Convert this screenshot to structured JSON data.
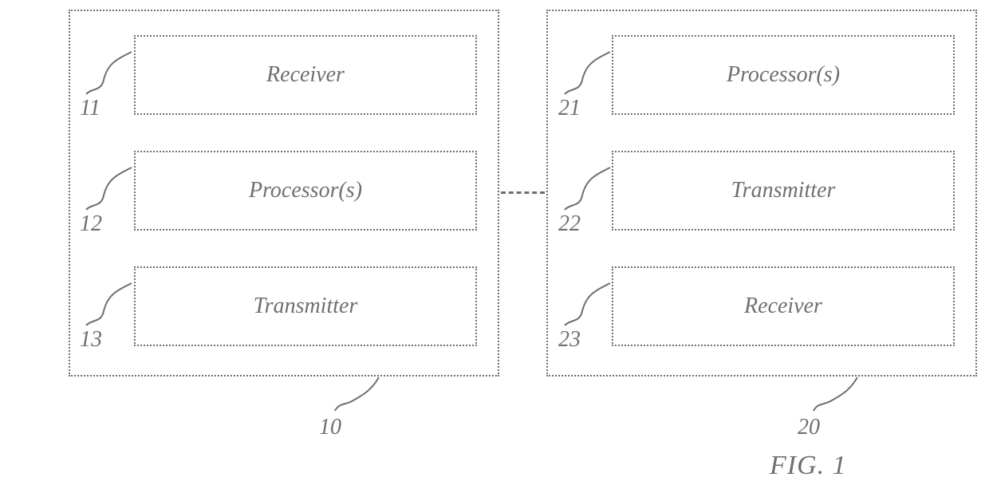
{
  "diagram": {
    "left": {
      "ref": "10",
      "blocks": [
        {
          "ref": "11",
          "label": "Receiver"
        },
        {
          "ref": "12",
          "label": "Processor(s)"
        },
        {
          "ref": "13",
          "label": "Transmitter"
        }
      ]
    },
    "right": {
      "ref": "20",
      "blocks": [
        {
          "ref": "21",
          "label": "Processor(s)"
        },
        {
          "ref": "22",
          "label": "Transmitter"
        },
        {
          "ref": "23",
          "label": "Receiver"
        }
      ]
    },
    "caption": "FIG. 1"
  }
}
